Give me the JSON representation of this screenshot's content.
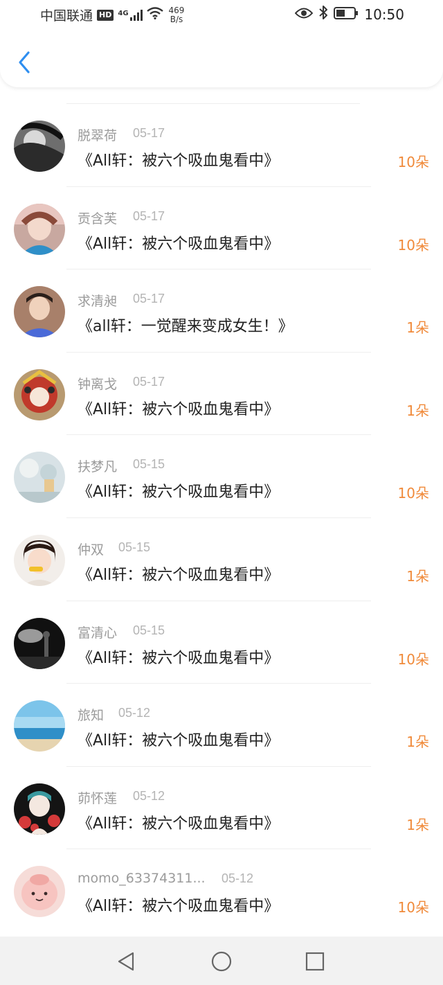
{
  "status_bar": {
    "carrier": "中国联通",
    "hd": "HD",
    "network": "4G",
    "speed_value": "469",
    "speed_unit": "B/s",
    "time": "10:50"
  },
  "colors": {
    "accent_blue": "#2e8ef0",
    "amount_orange": "#f08a3a",
    "name_gray": "#9b9b9b",
    "title_black": "#222222"
  },
  "icons": {
    "back": "chevron-left-icon",
    "nav_back": "triangle-back-icon",
    "nav_home": "circle-home-icon",
    "nav_recent": "square-recent-icon"
  },
  "gifts": [
    {
      "name": "脱翠荷",
      "date": "05-17",
      "title": "《All轩：被六个吸血鬼看中》",
      "amount": "10朵"
    },
    {
      "name": "贡含芙",
      "date": "05-17",
      "title": "《All轩：被六个吸血鬼看中》",
      "amount": "10朵"
    },
    {
      "name": "求清昶",
      "date": "05-17",
      "title": "《all轩：一觉醒来变成女生！》",
      "amount": "1朵"
    },
    {
      "name": "钟离戈",
      "date": "05-17",
      "title": "《All轩：被六个吸血鬼看中》",
      "amount": "1朵"
    },
    {
      "name": "扶梦凡",
      "date": "05-15",
      "title": "《All轩：被六个吸血鬼看中》",
      "amount": "10朵"
    },
    {
      "name": "仲双",
      "date": "05-15",
      "title": "《All轩：被六个吸血鬼看中》",
      "amount": "1朵"
    },
    {
      "name": "富清心",
      "date": "05-15",
      "title": "《All轩：被六个吸血鬼看中》",
      "amount": "10朵"
    },
    {
      "name": "旅知",
      "date": "05-12",
      "title": "《All轩：被六个吸血鬼看中》",
      "amount": "1朵"
    },
    {
      "name": "茆怀莲",
      "date": "05-12",
      "title": "《All轩：被六个吸血鬼看中》",
      "amount": "1朵"
    },
    {
      "name": "momo_63374311...",
      "date": "05-12",
      "title": "《All轩：被六个吸血鬼看中》",
      "amount": "10朵"
    }
  ]
}
